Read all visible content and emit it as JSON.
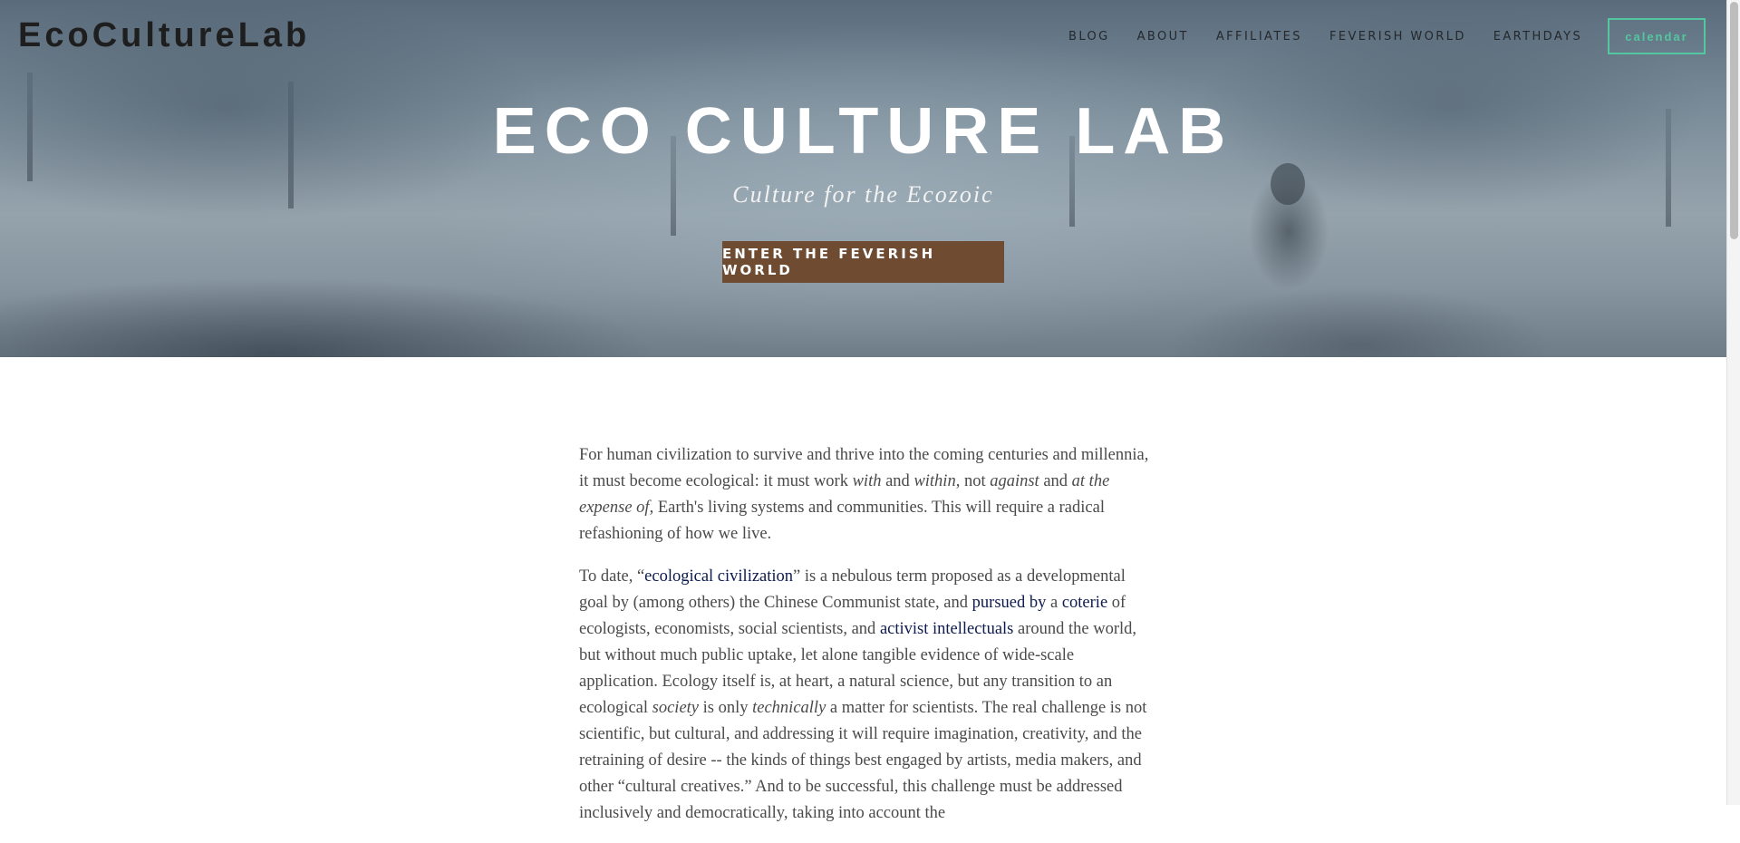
{
  "site": {
    "logo": "EcoCultureLab"
  },
  "nav": {
    "items": [
      "BLOG",
      "ABOUT",
      "AFFILIATES",
      "FEVERISH WORLD",
      "EARTHDAYS"
    ],
    "calendar_label": "calendar"
  },
  "hero": {
    "title": "ECO CULTURE LAB",
    "subtitle": "Culture for the Ecozoic",
    "button_label": "ENTER THE FEVERISH WORLD"
  },
  "article": {
    "p1": {
      "t1": "For human civilization to survive and thrive into the coming centuries and millennia, it must become ecological: it must work ",
      "e1": "with",
      "t2": " and ",
      "e2": "within",
      "t3": ", not ",
      "e3": "against",
      "t4": " and ",
      "e4": "at the expense of",
      "t5": ", Earth's living systems and communities. This will require a radical refashioning of how we live."
    },
    "p2": {
      "t1": "To date, “",
      "l1": "ecological civilization",
      "t2": "” is a nebulous term proposed as a developmental goal by (among others) the Chinese Communist state, and ",
      "l2": "pursued by",
      "t3": " a ",
      "l3": "coterie",
      "t4": " of ecologists, economists, social scientists, and ",
      "l4": "activist intellectuals",
      "t5": " around the world, but without much public uptake, let alone tangible evidence of wide-scale application. Ecology itself is, at heart, a natural science, but any transition to an ecological ",
      "e1": "society",
      "t6": " is only ",
      "e2": "technically",
      "t7": " a matter for scientists. The real challenge is not scientific, but cultural, and addressing it will require imagination, creativity, and the retraining of desire -- the kinds of things best engaged by artists, media makers, and other “cultural creatives.” And to be successful, this challenge must be addressed inclusively and democratically, taking into account the"
    }
  }
}
